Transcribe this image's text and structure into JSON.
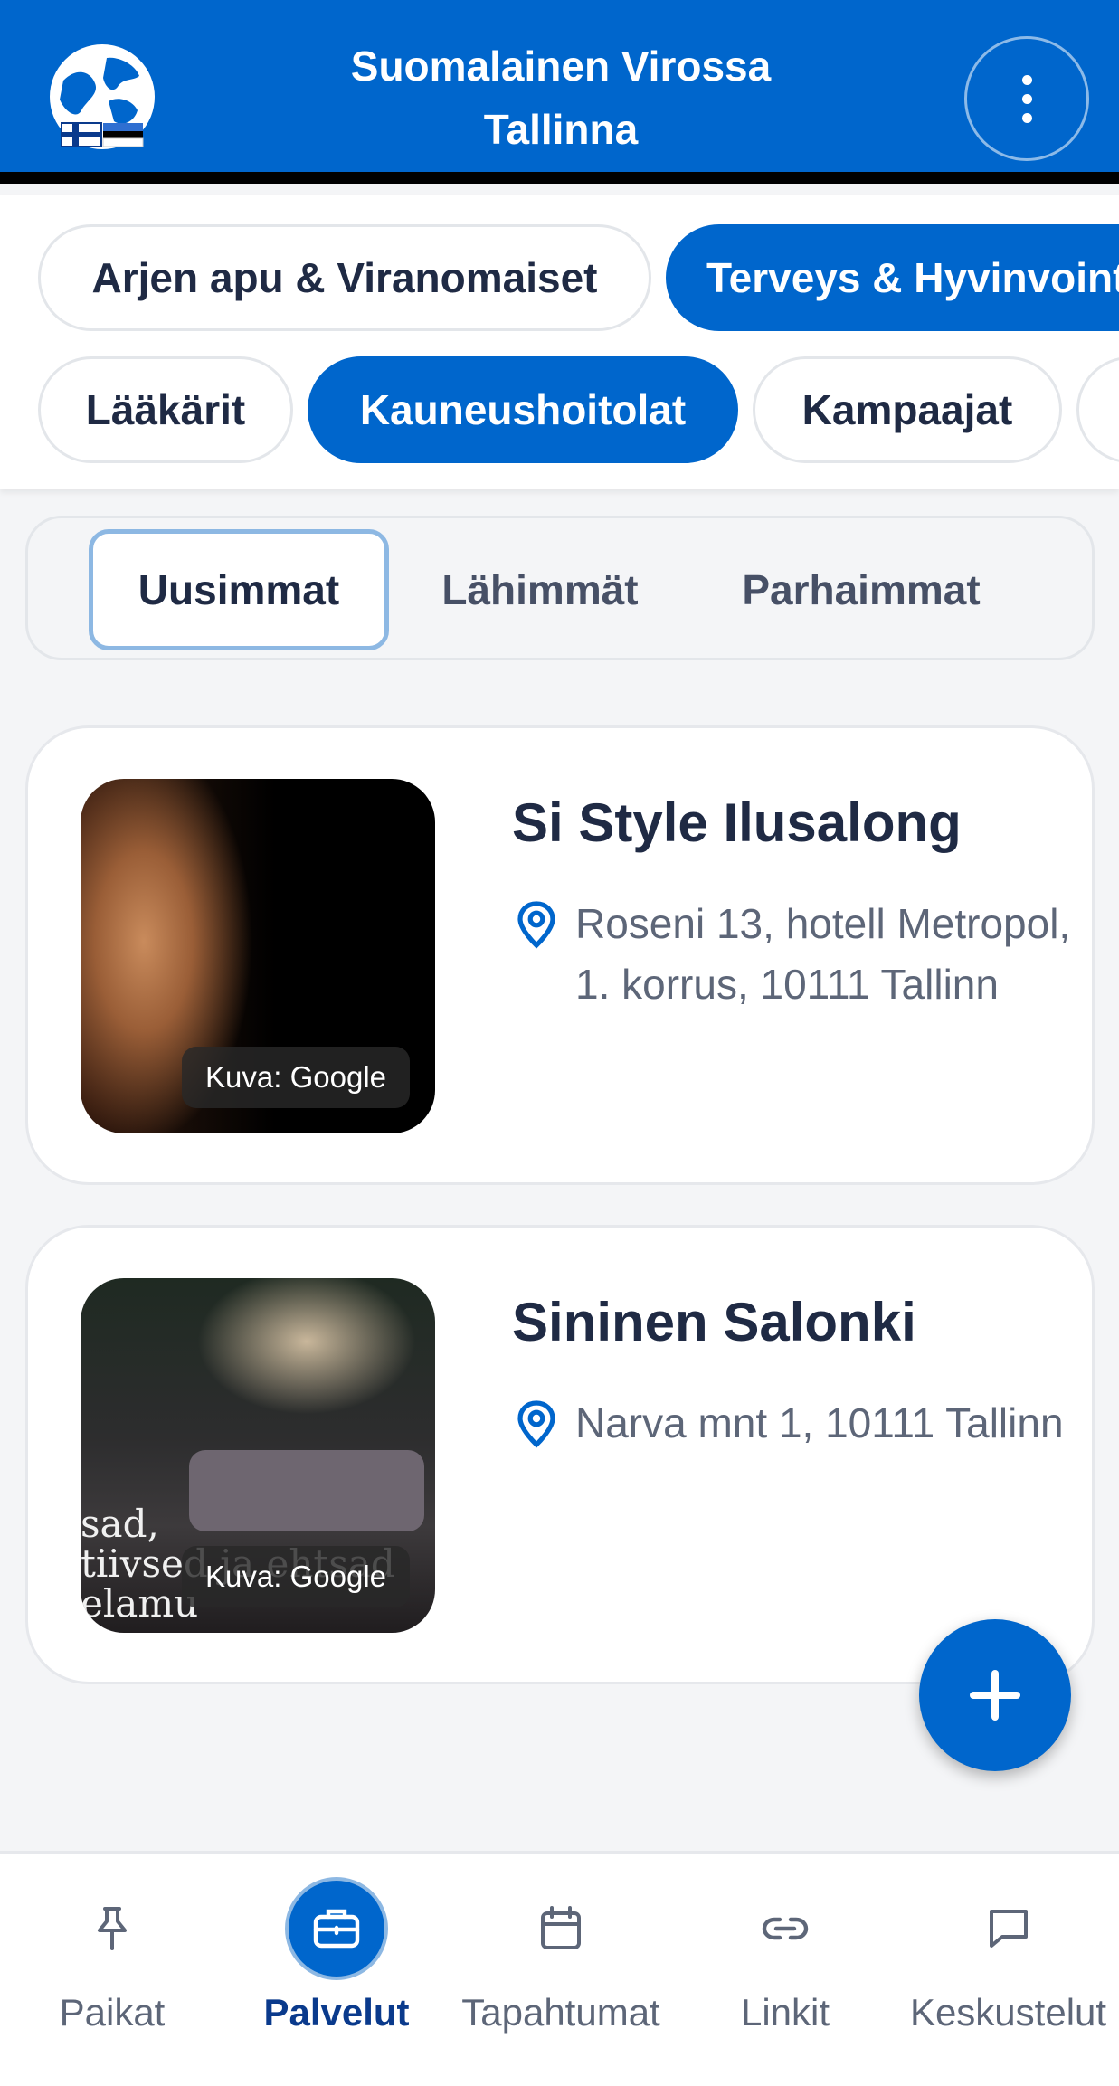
{
  "header": {
    "title_line1": "Suomalainen Virossa",
    "title_line2": "Tallinna",
    "logo_icon": "globe-flags-logo",
    "menu_icon": "more-vertical-icon"
  },
  "categories": [
    "Arjen apu & Viranomaiset",
    "Terveys & Hyvinvointi"
  ],
  "subcategories": [
    "Lääkärit",
    "Kauneushoitolat",
    "Kampaajat"
  ],
  "sort_tabs": [
    "Uusimmat",
    "Lähimmät",
    "Parhaimmat"
  ],
  "listings": [
    {
      "name": "Si Style Ilusalong",
      "address": "Roseni 13, hotell Metropol, 1. korrus, 10111 Tallinn",
      "image_credit": "Kuva: Google"
    },
    {
      "name": "Sininen Salonki",
      "address": "Narva mnt 1, 10111 Tallinn",
      "image_credit": "Kuva: Google",
      "image_text_line1": "sad,",
      "image_text_line2": "tiivsed ja ehtsad",
      "image_text_line3": "elamu"
    }
  ],
  "fab_icon": "plus-icon",
  "bottom_nav": [
    {
      "label": "Paikat",
      "icon": "pin-icon"
    },
    {
      "label": "Palvelut",
      "icon": "briefcase-icon"
    },
    {
      "label": "Tapahtumat",
      "icon": "calendar-icon"
    },
    {
      "label": "Linkit",
      "icon": "link-icon"
    },
    {
      "label": "Keskustelut",
      "icon": "chat-icon"
    }
  ],
  "colors": {
    "brand_blue": "#0066cc",
    "active_border": "#8db8e3",
    "text_dark": "#1f2a44",
    "text_muted": "#5d6678"
  }
}
